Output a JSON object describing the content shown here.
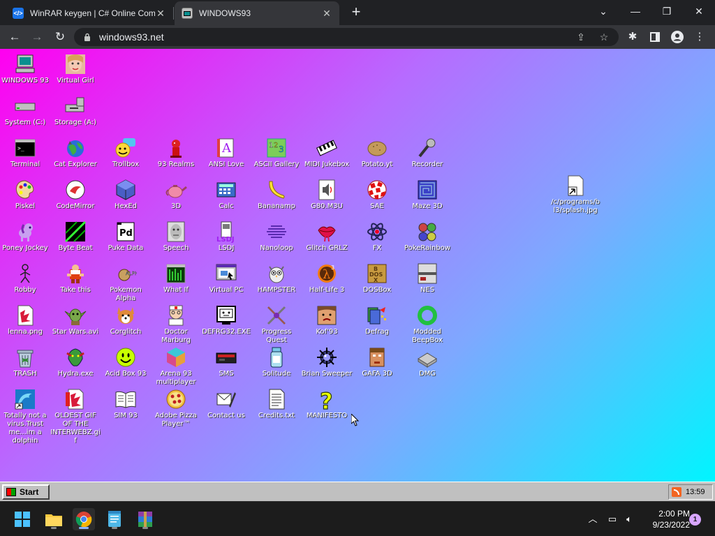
{
  "browser": {
    "tabs": [
      {
        "title": "WinRAR keygen | C# Online Com",
        "active": false
      },
      {
        "title": "WINDOWS93",
        "active": true
      }
    ],
    "url": "windows93.net"
  },
  "desktop": {
    "icons": [
      {
        "label": "WINDOWS 93",
        "icon": "computer-icon"
      },
      {
        "label": "Virtual Girl",
        "icon": "virtual-girl-icon"
      },
      {
        "label": "System (C:)",
        "icon": "drive-icon"
      },
      {
        "label": "Storage (A:)",
        "icon": "floppy-drive-icon"
      },
      {
        "label": "Terminal",
        "icon": "terminal-icon"
      },
      {
        "label": "Cat Explorer",
        "icon": "cat-globe-icon"
      },
      {
        "label": "Trollbox",
        "icon": "trollbox-icon"
      },
      {
        "label": "93 Realms",
        "icon": "realms-icon"
      },
      {
        "label": "ANSI Love",
        "icon": "ansi-icon"
      },
      {
        "label": "ASCII Gallery",
        "icon": "ascii-icon"
      },
      {
        "label": "MIDI Jukebox",
        "icon": "piano-icon"
      },
      {
        "label": "Potato.yt",
        "icon": "potato-icon"
      },
      {
        "label": "Recorder",
        "icon": "microphone-icon"
      },
      {
        "label": "Piskel",
        "icon": "palette-icon"
      },
      {
        "label": "CodeMirror",
        "icon": "codemirror-icon"
      },
      {
        "label": "HexEd",
        "icon": "cube-icon"
      },
      {
        "label": "3D",
        "icon": "teapot-icon"
      },
      {
        "label": "Calc",
        "icon": "calculator-icon"
      },
      {
        "label": "Bananamp",
        "icon": "banana-icon"
      },
      {
        "label": "G80.M3U",
        "icon": "playlist-icon"
      },
      {
        "label": "SAE",
        "icon": "ball-icon"
      },
      {
        "label": "Maze 3D",
        "icon": "maze-icon"
      },
      {
        "label": "Poney Jockey",
        "icon": "pony-icon"
      },
      {
        "label": "Byte Beat",
        "icon": "bytebeat-icon"
      },
      {
        "label": "Puke Data",
        "icon": "pd-icon"
      },
      {
        "label": "Speech",
        "icon": "face-icon"
      },
      {
        "label": "LSDJ",
        "icon": "gameboy-icon"
      },
      {
        "label": "Nanoloop",
        "icon": "nanoloop-icon"
      },
      {
        "label": "Glitch GRLZ",
        "icon": "lips-icon"
      },
      {
        "label": "FX",
        "icon": "atom-icon"
      },
      {
        "label": "PokeRainbow",
        "icon": "pokerainbow-icon"
      },
      {
        "label": "Robby",
        "icon": "stickman-icon"
      },
      {
        "label": "Take this",
        "icon": "takethis-icon"
      },
      {
        "label": "Pokemon Alpha",
        "icon": "poke-icon"
      },
      {
        "label": "What If",
        "icon": "whatif-icon"
      },
      {
        "label": "Virtual PC",
        "icon": "virtual-pc-icon"
      },
      {
        "label": "HAMPSTER",
        "icon": "owl-icon"
      },
      {
        "label": "Half-Life 3",
        "icon": "halflife-icon"
      },
      {
        "label": "DOSBox",
        "icon": "dosbox-icon"
      },
      {
        "label": "NES",
        "icon": "nes-icon"
      },
      {
        "label": "lenna.png",
        "icon": "image-file-icon"
      },
      {
        "label": "Star Wars.avi",
        "icon": "yoda-icon"
      },
      {
        "label": "Corglitch",
        "icon": "corgi-icon"
      },
      {
        "label": "Doctor Marburg",
        "icon": "doctor-icon"
      },
      {
        "label": "DEFRG32.EXE",
        "icon": "defrg-icon"
      },
      {
        "label": "Progress Quest",
        "icon": "swords-icon"
      },
      {
        "label": "Kof'93",
        "icon": "fighter-icon"
      },
      {
        "label": "Defrag",
        "icon": "defrag-icon"
      },
      {
        "label": "Modded BeepBox",
        "icon": "ring-icon"
      },
      {
        "label": "TRASH",
        "icon": "trash-icon"
      },
      {
        "label": "Hydra.exe",
        "icon": "hydra-icon"
      },
      {
        "label": "Acid Box 93",
        "icon": "smiley-icon"
      },
      {
        "label": "Arena 93 multiplayer",
        "icon": "arena-cube-icon"
      },
      {
        "label": "SMS",
        "icon": "console-icon"
      },
      {
        "label": "Solitude",
        "icon": "solitude-icon"
      },
      {
        "label": "Brian Sweeper",
        "icon": "mine-icon"
      },
      {
        "label": "GAFA 3D",
        "icon": "doomguy-icon"
      },
      {
        "label": "DMG",
        "icon": "dmg-icon"
      },
      {
        "label": "Totally not a virus.Trust me...im a dolphin",
        "icon": "dolphin-icon"
      },
      {
        "label": "OLDEST GIF OF THE INTERWEBZ.gif",
        "icon": "gif-file-icon"
      },
      {
        "label": "SIM 93",
        "icon": "book-icon"
      },
      {
        "label": "Adobe Pizza Player™",
        "icon": "pizza-icon"
      },
      {
        "label": "Contact us",
        "icon": "contact-icon"
      },
      {
        "label": "Credits.txt",
        "icon": "text-file-icon"
      },
      {
        "label": "MANIFESTO",
        "icon": "question-icon"
      },
      {
        "label": "/c/programs/bl3/splash.jpg",
        "icon": "shortcut-icon"
      }
    ]
  },
  "w93taskbar": {
    "start_label": "Start",
    "clock": "13:59"
  },
  "w11taskbar": {
    "time": "2:00 PM",
    "date": "9/23/2022",
    "notifications": "1"
  }
}
